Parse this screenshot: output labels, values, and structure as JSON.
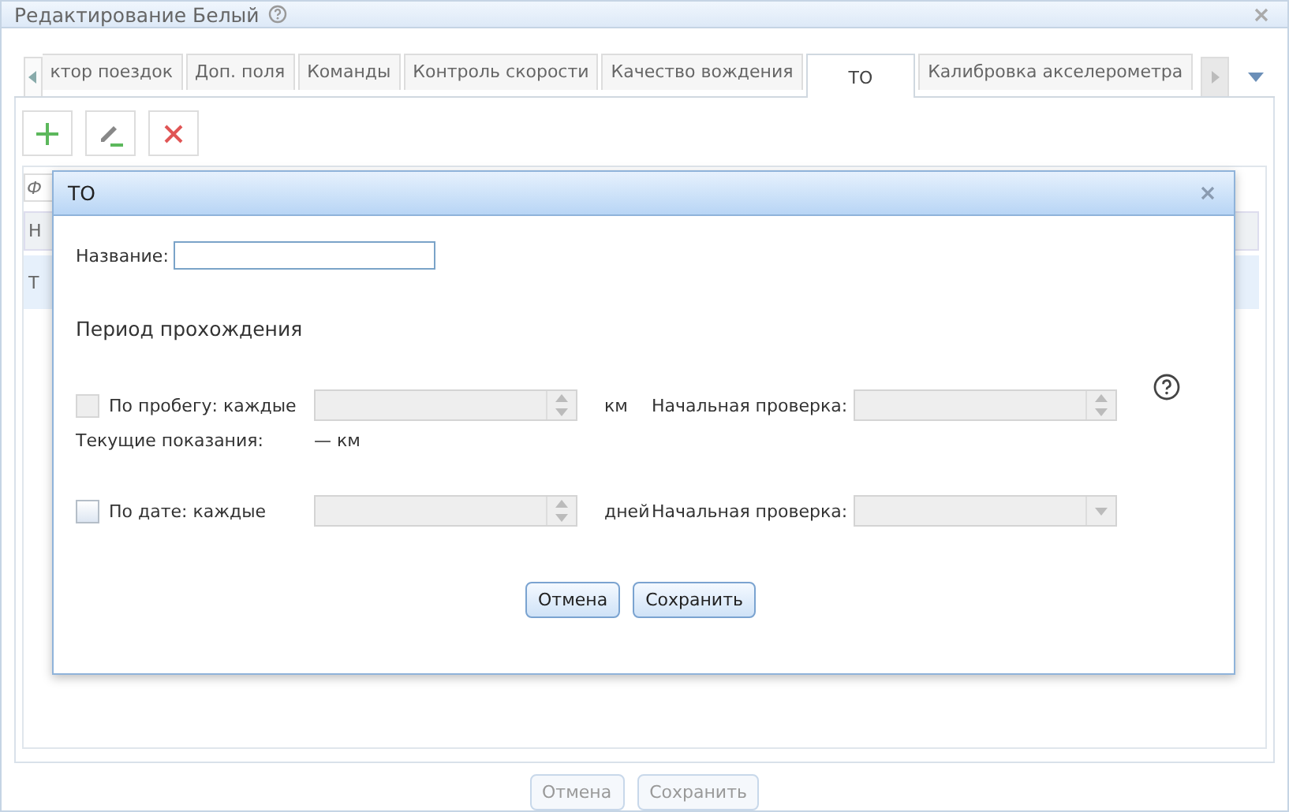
{
  "window": {
    "title": "Редактирование Белый"
  },
  "tabs": [
    {
      "label": "ктор поездок",
      "selected": false
    },
    {
      "label": "Доп. поля",
      "selected": false
    },
    {
      "label": "Команды",
      "selected": false
    },
    {
      "label": "Контроль скорости",
      "selected": false
    },
    {
      "label": "Качество вождения",
      "selected": false
    },
    {
      "label": "ТО",
      "selected": true
    },
    {
      "label": "Калибровка акселерометра",
      "selected": false
    }
  ],
  "grid": {
    "filter_placeholder": "Ф",
    "column_1": "Н",
    "rows": [
      "Т"
    ]
  },
  "footer_buttons": [
    {
      "label": "Отмена",
      "disabled": true
    },
    {
      "label": "Сохранить",
      "disabled": true
    }
  ],
  "dialog": {
    "title": "ТО",
    "name_label": "Название:",
    "section": "Период прохождения",
    "periods": [
      {
        "label": "По пробегу: каждые",
        "checked": false,
        "disabled": true,
        "unit": "км",
        "start_field": {
          "label": "Начальная проверка:",
          "kind": "spinner"
        },
        "help": true,
        "current": {
          "label": "Текущие показания:",
          "value": "— км"
        }
      },
      {
        "label": "По дате: каждые",
        "checked": false,
        "disabled": false,
        "unit": "дней",
        "start_field": {
          "label": "Начальная проверка:",
          "kind": "combo"
        }
      }
    ],
    "buttons": [
      {
        "label": "Отмена"
      },
      {
        "label": "Сохранить"
      }
    ]
  }
}
